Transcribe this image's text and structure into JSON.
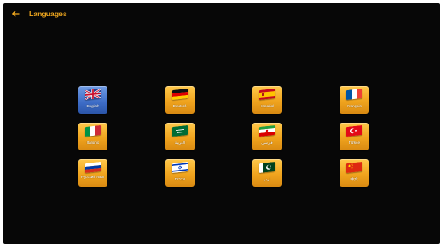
{
  "header": {
    "title": "Languages",
    "back_icon": "arrow-left-icon"
  },
  "colors": {
    "accent": "#f2a91f",
    "tile": "#f0a41e",
    "selected_tile": "#3d6cc6",
    "background": "#070707"
  },
  "languages": [
    {
      "label": "English",
      "flag_icon": "uk-flag-icon",
      "selected": true
    },
    {
      "label": "Deutsch",
      "flag_icon": "germany-flag-icon",
      "selected": false
    },
    {
      "label": "Español",
      "flag_icon": "spain-flag-icon",
      "selected": false
    },
    {
      "label": "Français",
      "flag_icon": "france-flag-icon",
      "selected": false
    },
    {
      "label": "Italiano",
      "flag_icon": "italy-flag-icon",
      "selected": false
    },
    {
      "label": "العربية",
      "flag_icon": "saudi-flag-icon",
      "selected": false
    },
    {
      "label": "فارسی",
      "flag_icon": "iran-flag-icon",
      "selected": false
    },
    {
      "label": "Türkçe",
      "flag_icon": "turkey-flag-icon",
      "selected": false
    },
    {
      "label": "Русский язык",
      "flag_icon": "russia-flag-icon",
      "selected": false
    },
    {
      "label": "עברית",
      "flag_icon": "israel-flag-icon",
      "selected": false
    },
    {
      "label": "اردو",
      "flag_icon": "pakistan-flag-icon",
      "selected": false
    },
    {
      "label": "中文",
      "flag_icon": "china-flag-icon",
      "selected": false
    }
  ]
}
